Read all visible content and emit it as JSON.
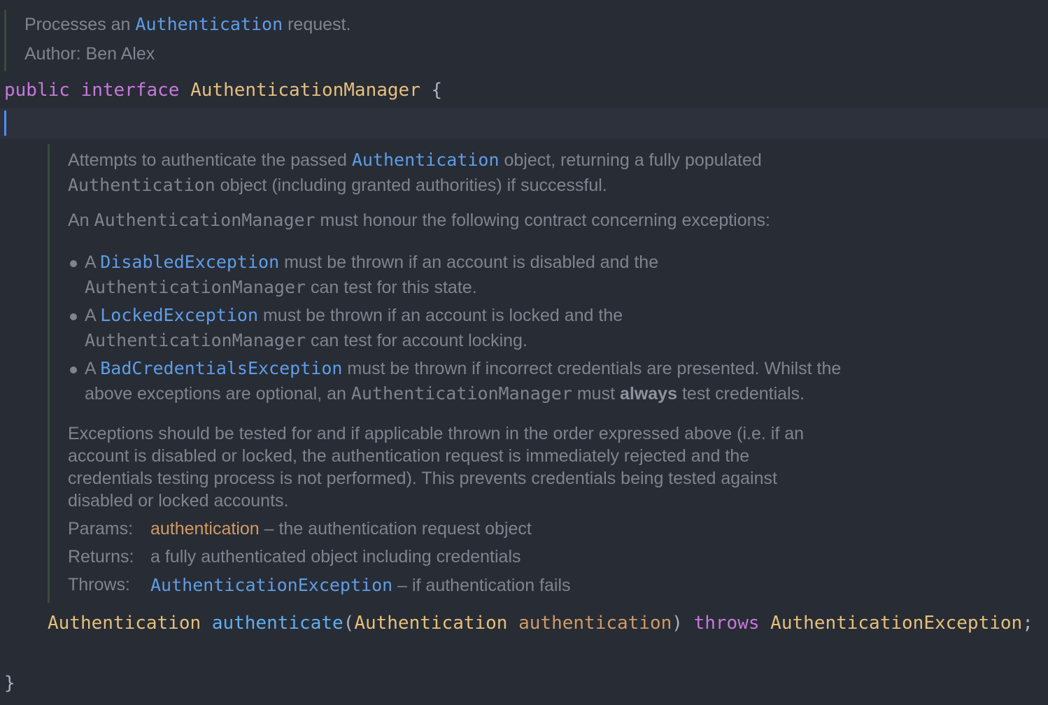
{
  "top_doc": {
    "line1_pre": "Processes an ",
    "line1_link": "Authentication",
    "line1_post": " request.",
    "author": "Author: Ben Alex"
  },
  "interface_line": {
    "kw_public": "public",
    "kw_interface": "interface",
    "name": "AuthenticationManager",
    "brace": "{"
  },
  "method_doc": {
    "p1_l1_pre": "Attempts to authenticate the passed ",
    "p1_l1_link": "Authentication",
    "p1_l1_post": " object, returning a fully populated",
    "p1_l2_code": "Authentication",
    "p1_l2_post": " object (including granted authorities) if successful.",
    "p2_pre": "An ",
    "p2_code": "AuthenticationManager",
    "p2_post": " must honour the following contract concerning exceptions:",
    "b1_l1_pre": "A ",
    "b1_l1_link": "DisabledException",
    "b1_l1_post": " must be thrown if an account is disabled and the",
    "b1_l2_code": "AuthenticationManager",
    "b1_l2_post": " can test for this state.",
    "b2_l1_pre": "A ",
    "b2_l1_link": "LockedException",
    "b2_l1_post": " must be thrown if an account is locked and the",
    "b2_l2_code": "AuthenticationManager",
    "b2_l2_post": " can test for account locking.",
    "b3_l1_pre": "A ",
    "b3_l1_link": "BadCredentialsException",
    "b3_l1_post": " must be thrown if incorrect credentials are presented. Whilst the",
    "b3_l2_pre": "above exceptions are optional, an ",
    "b3_l2_code": "AuthenticationManager",
    "b3_l2_mid": " must ",
    "b3_l2_bold": "always",
    "b3_l2_post": " test credentials.",
    "p3_l1": "Exceptions should be tested for and if applicable thrown in the order expressed above (i.e. if an",
    "p3_l2": "account is disabled or locked, the authentication request is immediately rejected and the",
    "p3_l3": "credentials testing process is not performed). This prevents credentials being tested against",
    "p3_l4": "disabled or locked accounts.",
    "params_label": "Params:",
    "params_name": "authentication",
    "params_desc": " – the authentication request object",
    "returns_label": "Returns:",
    "returns_desc": "a fully authenticated object including credentials",
    "throws_label": "Throws:",
    "throws_link": "AuthenticationException",
    "throws_desc": " – if authentication fails"
  },
  "method_line": {
    "ret_type": "Authentication",
    "name": "authenticate",
    "open": "(",
    "param_type": "Authentication",
    "param_name": "authentication",
    "close": ")",
    "kw_throws": "throws",
    "exc": "AuthenticationException",
    "semi": ";"
  },
  "closing_brace": "}",
  "colors": {
    "background": "#282c34",
    "keyword": "#c678dd",
    "type": "#e5c07b",
    "function": "#61afef",
    "param": "#d19a66",
    "doc_text": "#7f848e",
    "doc_link": "#5d9ee8"
  }
}
